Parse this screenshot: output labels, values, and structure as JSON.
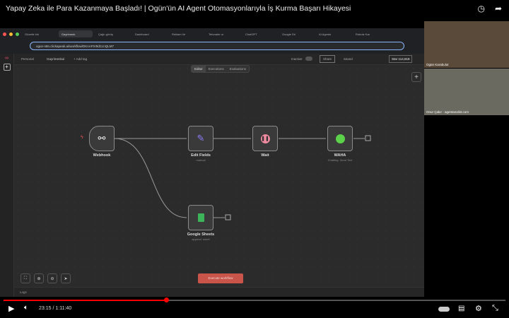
{
  "video": {
    "title": "Yapay Zeka ile Para Kazanmaya Başladı! | Ogün'ün AI Agent Otomasyonlarıyla İş Kurma Başarı Hikayesi",
    "time": "23:15 / 1:11:40",
    "progress_percent": 32.4,
    "accent": "#ff0000"
  },
  "browser": {
    "tabs": [
      "Gözetle kiri",
      "Gayrimenk",
      "Çağrı görüş",
      "Dashboard",
      "Reklam Ve",
      "Tetunaler ur",
      "ChatGPT",
      "Google Dri",
      "AI Agents",
      "Robotz Kar"
    ],
    "url": "ogun-n8n.clickapeak.ai/workflow/DKnAFtV9dCcnQLM7"
  },
  "n8n": {
    "breadcrumb_personal": "Personal",
    "workflow_name": "Gayrimenkul",
    "add_tag": "+ Add tag",
    "inactive": "Inactive",
    "share": "Share",
    "saved": "Saved",
    "star": "Star",
    "star_count": "114,818",
    "tabs": [
      "Editor",
      "Executions",
      "Evaluations"
    ],
    "nodes": [
      {
        "name": "Webhook",
        "sub": ""
      },
      {
        "name": "Edit Fields",
        "sub": "manual"
      },
      {
        "name": "Wait",
        "sub": ""
      },
      {
        "name": "WAHA",
        "sub": "Chatting: Send Text"
      },
      {
        "name": "Google Sheets",
        "sub": "append: sheet"
      }
    ],
    "execute": "Execute workflow",
    "logs": "Logs"
  },
  "cams": {
    "cam1": "Ogün Karabulut",
    "cam2": "Onur Çakır - agentanalist.com"
  }
}
